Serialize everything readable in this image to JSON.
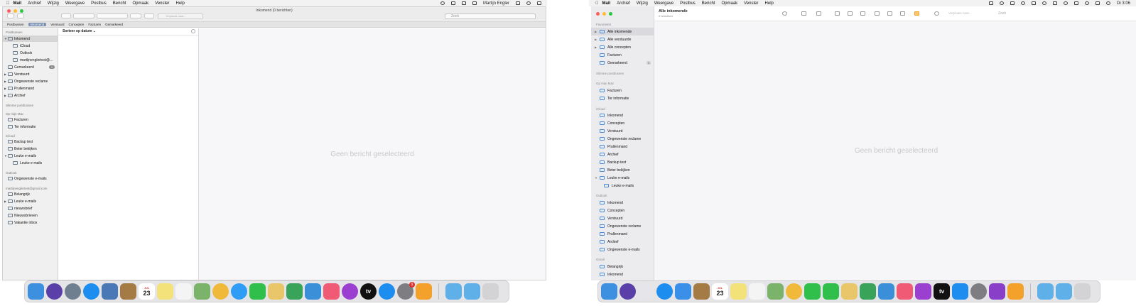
{
  "left": {
    "menu": {
      "app": "Mail",
      "items": [
        "Archief",
        "Wijzig",
        "Weergave",
        "Postbus",
        "Bericht",
        "Opmaak",
        "Venster",
        "Help"
      ],
      "user": "Martijn Engler"
    },
    "window_title": "Inkomend (0 berichten)",
    "toolbar": {
      "move_placeholder": "Verplaats naar...",
      "search_placeholder": "Zoek"
    },
    "favorites": {
      "postbussen": "Postbussen",
      "inkomend": "Inkomend",
      "verstuurd": "Verstuurd",
      "concepten": "Concepten",
      "facturen": "Facturen",
      "gemarkeerd": "Gemarkeerd"
    },
    "sidebar": {
      "postbussen_header": "Postbussen",
      "inkomend": "Inkomend",
      "icloud": "iCloud",
      "outlook": "Outlook",
      "gmail": "martijnenglertest@...",
      "gemarkeerd": "Gemarkeerd",
      "gemarkeerd_count": "1",
      "verstuurd": "Verstuurd",
      "ongewenste": "Ongewenste reclame",
      "prullenmand": "Prullenmand",
      "archief": "Archief",
      "slimme_header": "Slimme postbussen",
      "mac_header": "Op mijn Mac",
      "facturen": "Facturen",
      "ter_informatie": "Ter informatie",
      "icloud_header": "iCloud",
      "backup": "Backup test",
      "beter": "Beter bekijken",
      "leuke": "Leuke e-mails",
      "leuke_sub": "Leuke e-mails",
      "outlook_header": "Outlook",
      "ongewenste_mail": "Ongewenste e-mails",
      "gmail_header": "martijnenglertest@gmail.com",
      "belangrijk": "Belangrijk",
      "leuke2": "Leuke e-mails",
      "nieuwsbrief": "nieuwsbrief",
      "nieuwsbrieven": "Nieuwsbrieven",
      "vakantie": "Vakantie inbox"
    },
    "sort_label": "Sorteer op datum",
    "no_message": "Geen bericht geselecteerd"
  },
  "right": {
    "menu": {
      "app": "Mail",
      "items": [
        "Archief",
        "Wijzig",
        "Weergave",
        "Postbus",
        "Bericht",
        "Opmaak",
        "Venster",
        "Help"
      ],
      "clock": "Di 3:06"
    },
    "mailbox_title": "Alle inkomende",
    "mailbox_sub": "0 berichten",
    "toolbar": {
      "move_placeholder": "Verplaats naar...",
      "search_placeholder": "Zoek"
    },
    "sidebar": {
      "fav_header": "Favorieten",
      "alle_inkomende": "Alle inkomende",
      "alle_verstuurde": "Alle verstuurde",
      "alle_concepten": "Alle concepten",
      "facturen": "Facturen",
      "gemarkeerd": "Gemarkeerd",
      "gemarkeerd_count": "1",
      "slimme_header": "Slimme postbussen",
      "mac_header": "Op mijn Mac",
      "mac_facturen": "Facturen",
      "ter_informatie": "Ter informatie",
      "icloud_header": "iCloud",
      "ic_inkomend": "Inkomend",
      "ic_concepten": "Concepten",
      "ic_verstuurd": "Verstuurd",
      "ic_ongewenste": "Ongewenste reclame",
      "ic_prullenmand": "Prullenmand",
      "ic_archief": "Archief",
      "ic_backup": "Backup test",
      "ic_beter": "Beter bekijken",
      "ic_leuke": "Leuke e-mails",
      "ic_leuke_sub": "Leuke e-mails",
      "outlook_header": "Outlook",
      "ol_inkomend": "Inkomend",
      "ol_concepten": "Concepten",
      "ol_verstuurd": "Verstuurd",
      "ol_ongewenste": "Ongewenste reclame",
      "ol_prullenmand": "Prullenmand",
      "ol_archief": "Archief",
      "ol_ongewenste_mail": "Ongewenste e-mails",
      "gmail_header": "Gmail",
      "gm_belangrijk": "Belangrijk",
      "gm_inkomend": "Inkomend"
    },
    "no_message": "Geen bericht geselecteerd"
  },
  "dock": {
    "calendar_month": "JUL",
    "calendar_day": "23",
    "appstore_badge": "1",
    "appletv_label": "tv"
  }
}
